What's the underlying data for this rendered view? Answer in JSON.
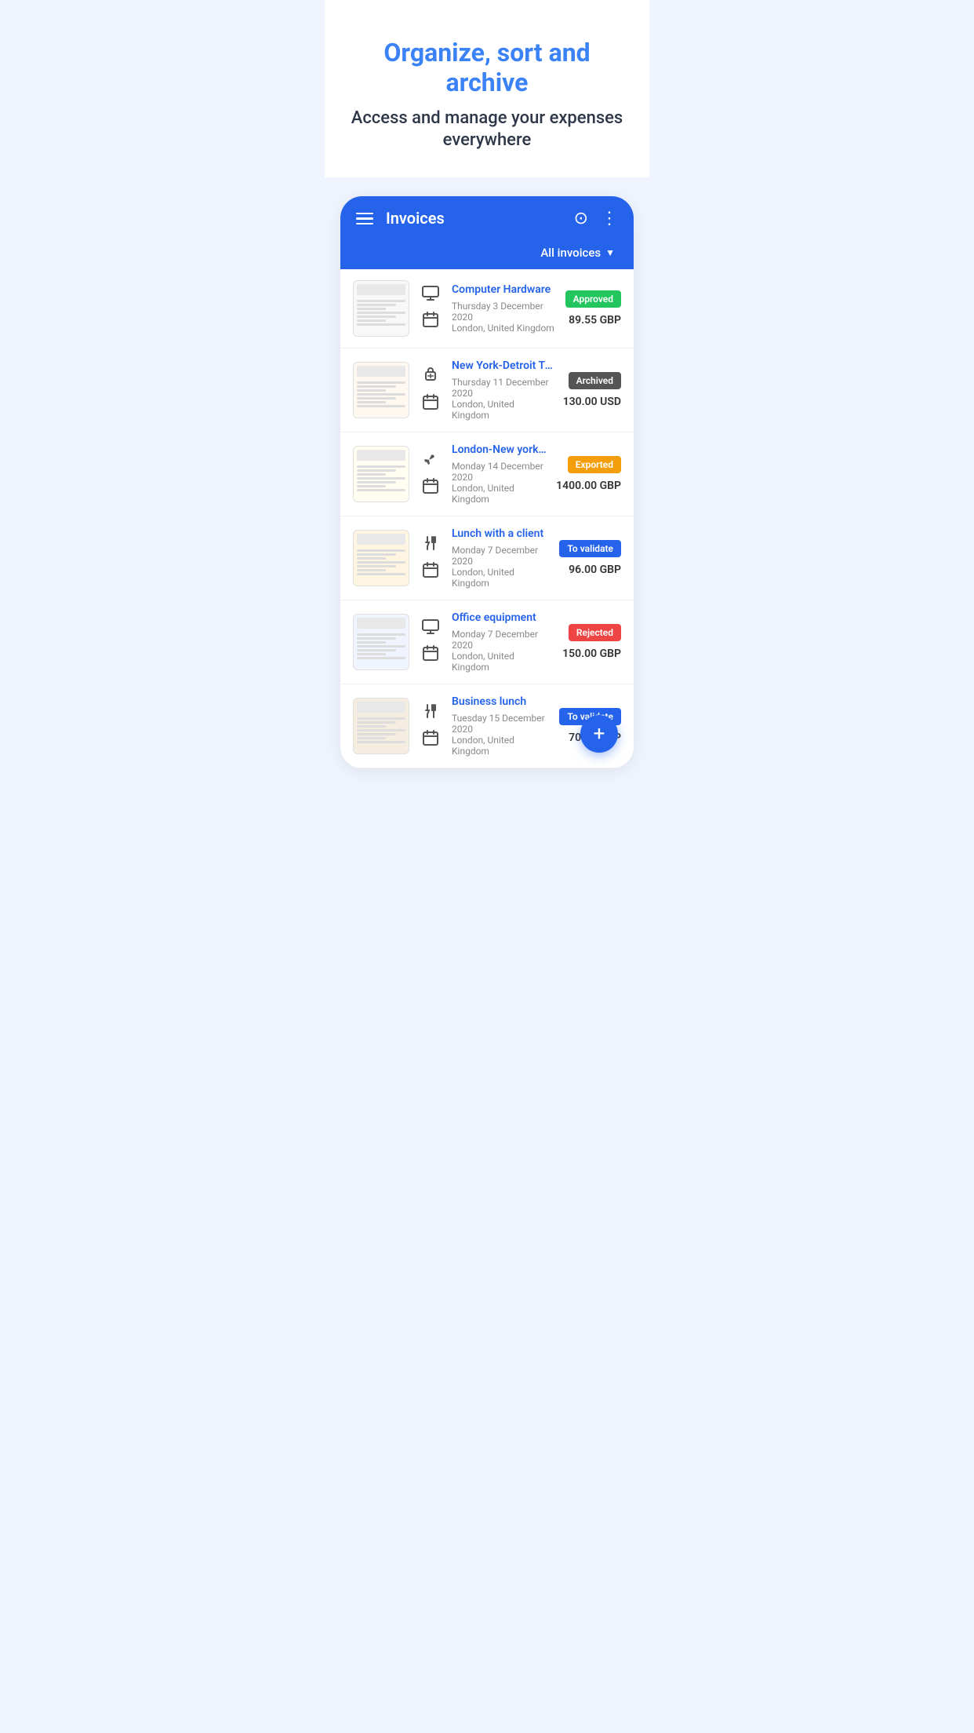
{
  "hero": {
    "title": "Organize, sort and archive",
    "subtitle": "Access and manage your expenses everywhere"
  },
  "header": {
    "title": "Invoices",
    "filter_label": "All invoices"
  },
  "invoices": [
    {
      "name": "Computer Hardware",
      "date": "Thursday 3 December 2020",
      "location": "London, United Kingdom",
      "amount": "89.55 GBP",
      "status": "Approved",
      "status_class": "badge-approved",
      "category": "computer",
      "thumb_class": ""
    },
    {
      "name": "New York-Detroit Train",
      "date": "Thursday 11 December 2020",
      "location": "London, United Kingdom",
      "amount": "130.00 USD",
      "status": "Archived",
      "status_class": "badge-archived",
      "category": "train",
      "thumb_class": "train"
    },
    {
      "name": "London-New york flight",
      "date": "Monday 14 December 2020",
      "location": "London, United Kingdom",
      "amount": "1400.00 GBP",
      "status": "Exported",
      "status_class": "badge-exported",
      "category": "flight",
      "thumb_class": "flight"
    },
    {
      "name": "Lunch with a client",
      "date": "Monday 7 December 2020",
      "location": "London, United Kingdom",
      "amount": "96.00 GBP",
      "status": "To validate",
      "status_class": "badge-to-validate",
      "category": "food",
      "thumb_class": "lunch"
    },
    {
      "name": "Office equipment",
      "date": "Monday 7 December 2020",
      "location": "London, United Kingdom",
      "amount": "150.00 GBP",
      "status": "Rejected",
      "status_class": "badge-rejected",
      "category": "computer",
      "thumb_class": "office"
    },
    {
      "name": "Business lunch",
      "date": "Tuesday 15 December 2020",
      "location": "London, United Kingdom",
      "amount": "70.00 GBP",
      "status": "To validate",
      "status_class": "badge-to-validate",
      "category": "food",
      "thumb_class": "business"
    }
  ],
  "fab": {
    "label": "+"
  },
  "icons": {
    "computer": "🖥",
    "train": "🧳",
    "flight": "✈",
    "food": "🍴",
    "calendar": "📅"
  }
}
